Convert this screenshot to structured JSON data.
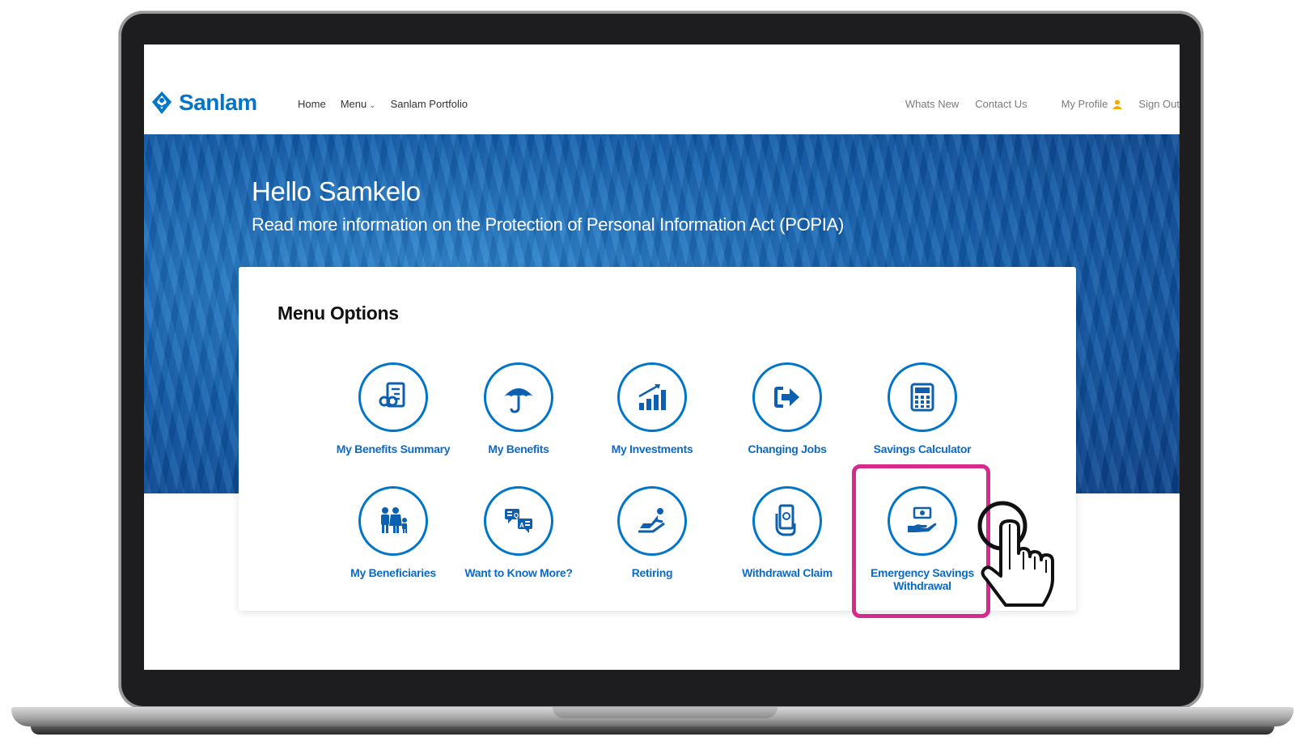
{
  "brand": {
    "name": "Sanlam",
    "color": "#0075c9"
  },
  "nav_left": [
    "Home",
    "Menu",
    "Sanlam Portfolio"
  ],
  "nav_right": {
    "whats_new": "Whats New",
    "contact": "Contact Us",
    "profile": "My Profile",
    "sign_out": "Sign Out"
  },
  "banner": {
    "greeting": "Hello Samkelo",
    "popia_link": "Read more information on the Protection of Personal Information Act (POPIA)"
  },
  "menu": {
    "title": "Menu Options",
    "row1": [
      "My Benefits Summary",
      "My Benefits",
      "My Investments",
      "Changing Jobs",
      "Savings Calculator"
    ],
    "row2": [
      "My Beneficiaries",
      "Want to Know More?",
      "Retiring",
      "Withdrawal Claim",
      "Emergency Savings Withdrawal"
    ],
    "icons_row1": [
      "benefits-summary-icon",
      "umbrella-icon",
      "investments-chart-icon",
      "exit-arrow-icon",
      "calculator-icon"
    ],
    "icons_row2": [
      "family-icon",
      "faq-chat-icon",
      "reclining-chair-icon",
      "money-hand-icon",
      "cash-hand-icon"
    ]
  },
  "colors": {
    "accent": "#0075c9",
    "highlight": "#d62a8c",
    "label": "#0d6ac4"
  }
}
